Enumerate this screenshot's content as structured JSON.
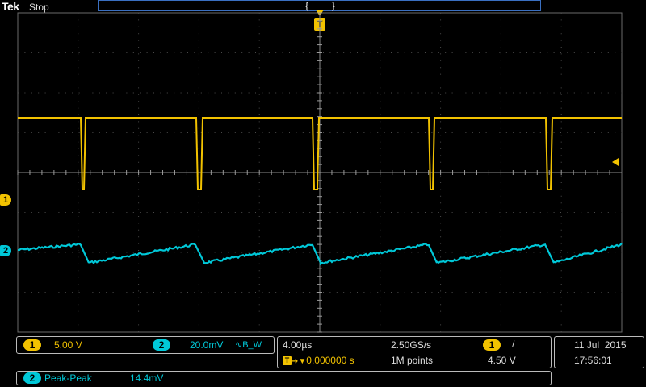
{
  "header": {
    "brand": "Tek",
    "status": "Stop",
    "trigger_marker": "T"
  },
  "channels": {
    "ch1": {
      "label": "1",
      "scale": "5.00 V",
      "color": "#f2c200"
    },
    "ch2": {
      "label": "2",
      "scale": "20.0mV",
      "bw_symbol": "∿B_W",
      "color": "#00c8d8"
    }
  },
  "timebase": {
    "horizontal_scale": "4.00µs",
    "sample_rate": "2.50GS/s",
    "trigger_delay": "0.000000 s",
    "record_length": "1M points"
  },
  "trigger": {
    "source": "1",
    "slope": "/",
    "level": "4.50 V"
  },
  "datetime": {
    "date": "11 Jul  2015",
    "time": "17:56:01"
  },
  "measurement": {
    "source": "2",
    "name": "Peak-Peak",
    "value": "14.4mV"
  }
}
